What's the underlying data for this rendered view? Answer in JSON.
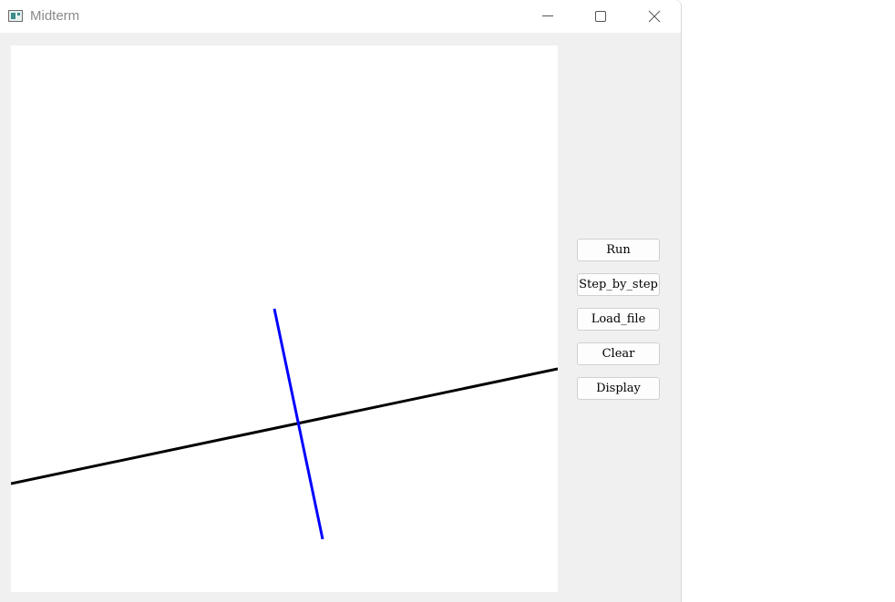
{
  "window": {
    "title": "Midterm"
  },
  "controls": {
    "run_label": "Run",
    "step_label": "Step_by_step",
    "load_label": "Load_file",
    "clear_label": "Clear",
    "display_label": "Display"
  },
  "colors": {
    "window_bg": "#f0f0f0",
    "canvas_bg": "#ffffff",
    "black_line": "#000000",
    "blue_line": "#0000ff"
  }
}
